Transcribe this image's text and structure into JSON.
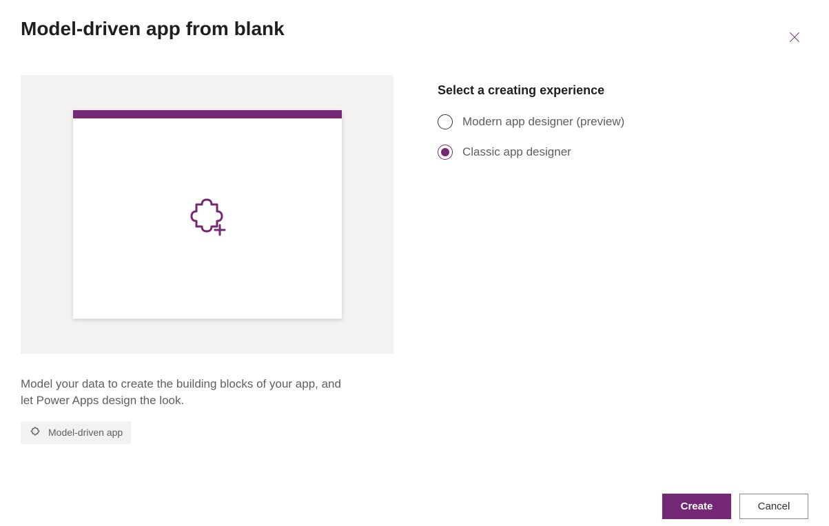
{
  "title": "Model-driven app from blank",
  "description": "Model your data to create the building blocks of your app, and let Power Apps design the look.",
  "tag": {
    "label": "Model-driven app"
  },
  "right": {
    "sectionTitle": "Select a creating experience",
    "options": [
      {
        "label": "Modern app designer (preview)",
        "selected": false
      },
      {
        "label": "Classic app designer",
        "selected": true
      }
    ]
  },
  "footer": {
    "primary": "Create",
    "secondary": "Cancel"
  }
}
